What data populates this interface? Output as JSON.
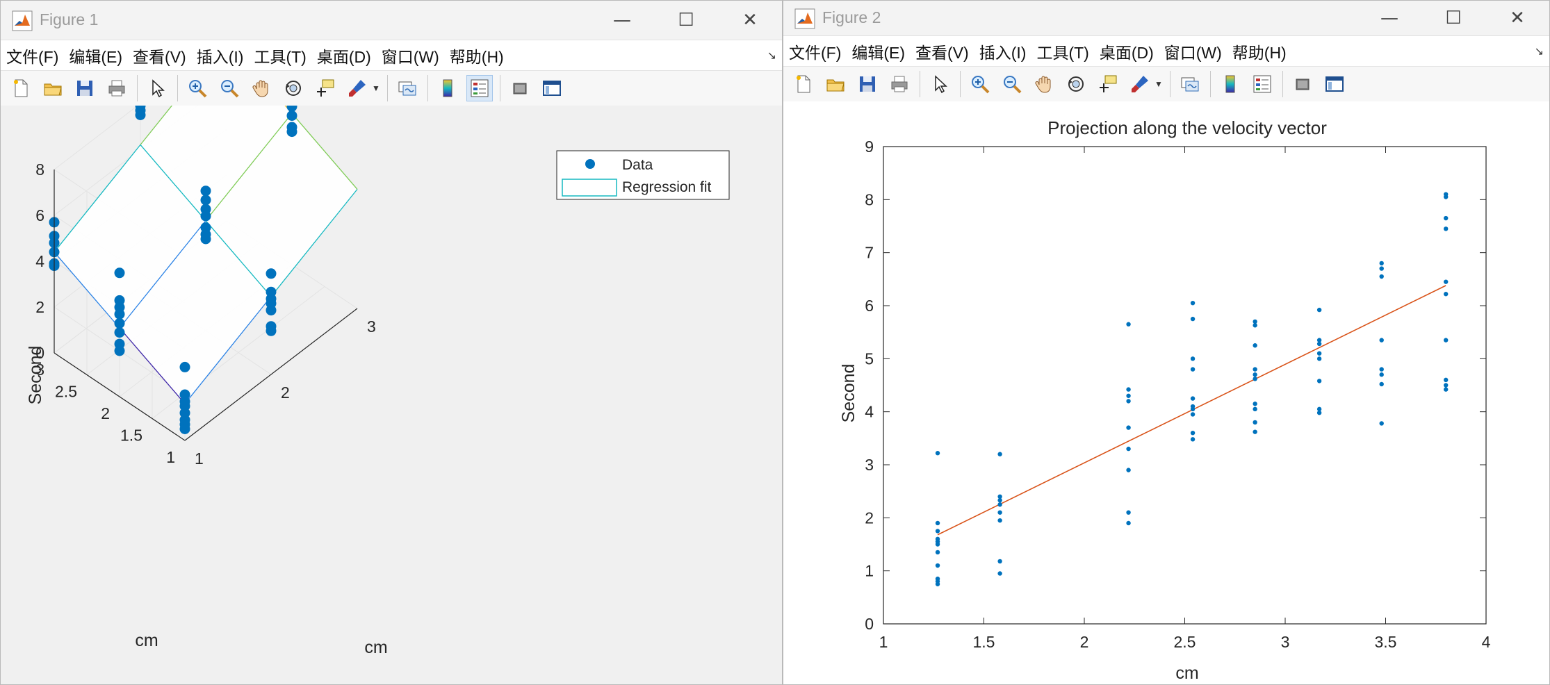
{
  "windows": [
    {
      "title": "Figure 1",
      "menu": [
        "文件(F)",
        "编辑(E)",
        "查看(V)",
        "插入(I)",
        "工具(T)",
        "桌面(D)",
        "窗口(W)",
        "帮助(H)"
      ]
    },
    {
      "title": "Figure 2",
      "menu": [
        "文件(F)",
        "编辑(E)",
        "查看(V)",
        "插入(I)",
        "工具(T)",
        "桌面(D)",
        "窗口(W)",
        "帮助(H)"
      ]
    }
  ],
  "window_controls": {
    "minimize": "—",
    "maximize": "☐",
    "close": "✕"
  },
  "toolbar_icons": [
    "new-figure-icon",
    "open-icon",
    "save-icon",
    "print-icon",
    "select-arrow-icon",
    "zoom-in-icon",
    "zoom-out-icon",
    "pan-hand-icon",
    "rotate-3d-icon",
    "data-cursor-icon",
    "brush-icon",
    "link-plot-icon",
    "colorbar-icon",
    "legend-icon",
    "hide-plot-tools-icon",
    "show-plot-tools-icon"
  ],
  "colors": {
    "marker": "#0072bd",
    "fit_line": "#d95319",
    "surface_colormap": [
      "#3e26a8",
      "#2a82e6",
      "#15b9c1",
      "#7fcc56",
      "#f5c52c"
    ]
  },
  "chart_data": [
    {
      "type": "scatter3d",
      "title": "",
      "xlabel": "cm",
      "ylabel": "cm",
      "zlabel": "Second",
      "xticks": [
        1,
        2,
        3
      ],
      "yticks": [
        1,
        1.5,
        2,
        2.5,
        3
      ],
      "zticks": [
        0,
        2,
        4,
        6,
        8
      ],
      "xlim": [
        1,
        3
      ],
      "ylim": [
        1,
        3
      ],
      "zlim": [
        0,
        8
      ],
      "grid": true,
      "legend": {
        "position": "top-right",
        "entries": [
          "Data",
          "Regression fit"
        ]
      },
      "surface": {
        "x": [
          1,
          2,
          3
        ],
        "y": [
          1,
          2,
          3
        ],
        "z": [
          [
            1.6,
            3.4,
            5.2
          ],
          [
            3.0,
            4.8,
            6.6
          ],
          [
            4.4,
            6.2,
            8.0
          ]
        ]
      },
      "points": [
        [
          1,
          1,
          0.5
        ],
        [
          1,
          1,
          0.7
        ],
        [
          1,
          1,
          0.9
        ],
        [
          1,
          1,
          1.2
        ],
        [
          1,
          1,
          1.5
        ],
        [
          1,
          1,
          1.7
        ],
        [
          1,
          1,
          2.0
        ],
        [
          1,
          1,
          3.2
        ],
        [
          1,
          2,
          2.0
        ],
        [
          1,
          2,
          2.3
        ],
        [
          1,
          2,
          2.8
        ],
        [
          1,
          2,
          3.2
        ],
        [
          1,
          2,
          3.6
        ],
        [
          1,
          2,
          3.9
        ],
        [
          1,
          2,
          4.2
        ],
        [
          1,
          2,
          5.4
        ],
        [
          1,
          3,
          3.8
        ],
        [
          1,
          3,
          3.9
        ],
        [
          1,
          3,
          4.4
        ],
        [
          1,
          3,
          4.8
        ],
        [
          1,
          3,
          5.1
        ],
        [
          1,
          3,
          5.7
        ],
        [
          2,
          1,
          1.9
        ],
        [
          2,
          1,
          2.1
        ],
        [
          2,
          1,
          2.8
        ],
        [
          2,
          1,
          3.1
        ],
        [
          2,
          1,
          3.3
        ],
        [
          2,
          1,
          3.6
        ],
        [
          2,
          1,
          4.4
        ],
        [
          2,
          2,
          4.0
        ],
        [
          2,
          2,
          4.2
        ],
        [
          2,
          2,
          4.5
        ],
        [
          2,
          2,
          5.0
        ],
        [
          2,
          2,
          5.3
        ],
        [
          2,
          2,
          5.7
        ],
        [
          2,
          2,
          6.1
        ],
        [
          2,
          3,
          7.5
        ],
        [
          2,
          3,
          7.7
        ],
        [
          2,
          3,
          7.9
        ],
        [
          3,
          2,
          5.8
        ],
        [
          3,
          2,
          6.0
        ],
        [
          3,
          2,
          6.5
        ],
        [
          3,
          2,
          6.9
        ],
        [
          3,
          3,
          7.4
        ],
        [
          3,
          3,
          8.8
        ],
        [
          3,
          3,
          9.2
        ],
        [
          3,
          3,
          9.6
        ]
      ]
    },
    {
      "type": "scatter",
      "title": "Projection along the velocity vector",
      "xlabel": "cm",
      "ylabel": "Second",
      "xlim": [
        1,
        4
      ],
      "ylim": [
        0,
        9
      ],
      "xticks": [
        1,
        1.5,
        2,
        2.5,
        3,
        3.5,
        4
      ],
      "yticks": [
        0,
        1,
        2,
        3,
        4,
        5,
        6,
        7,
        8,
        9
      ],
      "grid": false,
      "fit_line": {
        "x": [
          1.27,
          3.8
        ],
        "y": [
          1.68,
          6.38
        ]
      },
      "points": [
        [
          1.27,
          0.75
        ],
        [
          1.27,
          0.8
        ],
        [
          1.27,
          0.85
        ],
        [
          1.27,
          1.1
        ],
        [
          1.27,
          1.35
        ],
        [
          1.27,
          1.5
        ],
        [
          1.27,
          1.55
        ],
        [
          1.27,
          1.6
        ],
        [
          1.27,
          1.75
        ],
        [
          1.27,
          1.9
        ],
        [
          1.27,
          3.22
        ],
        [
          1.58,
          0.95
        ],
        [
          1.58,
          1.18
        ],
        [
          1.58,
          1.95
        ],
        [
          1.58,
          2.1
        ],
        [
          1.58,
          2.25
        ],
        [
          1.58,
          2.33
        ],
        [
          1.58,
          2.4
        ],
        [
          1.58,
          3.2
        ],
        [
          2.22,
          1.9
        ],
        [
          2.22,
          2.1
        ],
        [
          2.22,
          2.9
        ],
        [
          2.22,
          3.3
        ],
        [
          2.22,
          3.7
        ],
        [
          2.22,
          4.2
        ],
        [
          2.22,
          4.3
        ],
        [
          2.22,
          4.42
        ],
        [
          2.22,
          5.65
        ],
        [
          2.54,
          3.48
        ],
        [
          2.54,
          3.6
        ],
        [
          2.54,
          3.95
        ],
        [
          2.54,
          4.05
        ],
        [
          2.54,
          4.1
        ],
        [
          2.54,
          4.25
        ],
        [
          2.54,
          4.8
        ],
        [
          2.54,
          5.0
        ],
        [
          2.54,
          5.75
        ],
        [
          2.54,
          6.05
        ],
        [
          2.85,
          3.62
        ],
        [
          2.85,
          3.8
        ],
        [
          2.85,
          4.05
        ],
        [
          2.85,
          4.15
        ],
        [
          2.85,
          4.62
        ],
        [
          2.85,
          4.7
        ],
        [
          2.85,
          4.8
        ],
        [
          2.85,
          5.25
        ],
        [
          2.85,
          5.63
        ],
        [
          2.85,
          5.7
        ],
        [
          3.17,
          3.98
        ],
        [
          3.17,
          4.05
        ],
        [
          3.17,
          4.58
        ],
        [
          3.17,
          5.0
        ],
        [
          3.17,
          5.1
        ],
        [
          3.17,
          5.28
        ],
        [
          3.17,
          5.35
        ],
        [
          3.17,
          5.92
        ],
        [
          3.48,
          3.78
        ],
        [
          3.48,
          4.52
        ],
        [
          3.48,
          4.7
        ],
        [
          3.48,
          4.8
        ],
        [
          3.48,
          5.35
        ],
        [
          3.48,
          6.55
        ],
        [
          3.48,
          6.7
        ],
        [
          3.48,
          6.8
        ],
        [
          3.8,
          4.42
        ],
        [
          3.8,
          4.5
        ],
        [
          3.8,
          4.6
        ],
        [
          3.8,
          5.35
        ],
        [
          3.8,
          6.22
        ],
        [
          3.8,
          6.45
        ],
        [
          3.8,
          7.45
        ],
        [
          3.8,
          7.65
        ],
        [
          3.8,
          8.05
        ],
        [
          3.8,
          8.1
        ]
      ]
    }
  ]
}
